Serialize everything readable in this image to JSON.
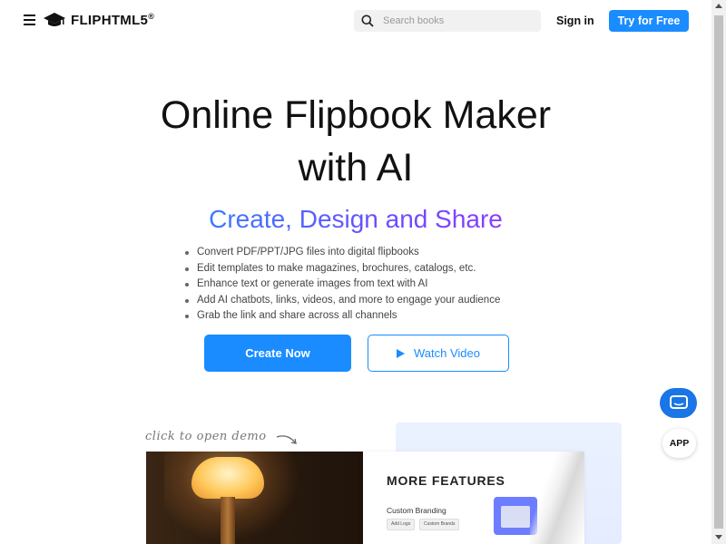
{
  "header": {
    "logo_text": "FLIPHTML5",
    "logo_mark": "®",
    "search_placeholder": "Search books",
    "signin_label": "Sign in",
    "try_label": "Try for Free"
  },
  "hero": {
    "title_line1": "Online Flipbook Maker",
    "title_line2": "with AI",
    "subtitle": "Create, Design and Share",
    "features": [
      "Convert PDF/PPT/JPG files into digital flipbooks",
      "Edit templates to make magazines, brochures, catalogs, etc.",
      "Enhance text or generate images from text with AI",
      "Add AI chatbots, links, videos, and more to engage your audience",
      "Grab the link and share across all channels"
    ],
    "create_label": "Create Now",
    "watch_label": "Watch Video"
  },
  "floating": {
    "app_label": "APP"
  },
  "demo": {
    "hint": "click to open demo",
    "more_features": "MORE FEATURES",
    "custom_branding": "Custom Branding",
    "chip1": "Add Logo",
    "chip2": "Custom Brands"
  },
  "colors": {
    "accent": "#1a8cff",
    "chat": "#1a75e6",
    "gradient_start": "#3a7bff",
    "gradient_end": "#8a3dff"
  },
  "icons": {
    "menu": "hamburger-icon",
    "logo": "graduation-cap-icon",
    "search": "magnifier-icon",
    "play": "play-icon",
    "chat": "chat-bubble-icon",
    "arrow": "curved-arrow-icon"
  }
}
